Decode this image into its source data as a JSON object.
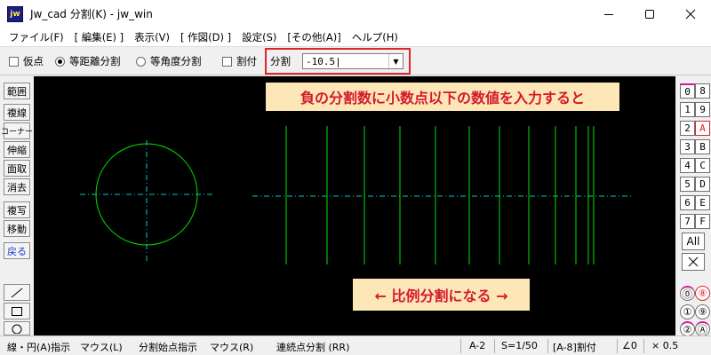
{
  "window": {
    "title": "Jw_cad 分割(K) - jw_win",
    "app_icon_text": "jw"
  },
  "menu": [
    "ファイル(F)",
    "[ 編集(E) ]",
    "表示(V)",
    "[ 作図(D) ]",
    "設定(S)",
    "[その他(A)]",
    "ヘルプ(H)"
  ],
  "toolbar": {
    "karite": "仮点",
    "equal_distance": "等距離分割",
    "equal_angle": "等角度分割",
    "waritsuke": "割付",
    "division_label": "分割",
    "division_value": "-10.5|"
  },
  "left_buttons": [
    "範囲",
    "複線",
    "コーナー",
    "伸縮",
    "面取",
    "消去",
    "複写",
    "移動",
    "戻る"
  ],
  "right_buttons": {
    "col1": [
      "0",
      "1",
      "2",
      "3",
      "4",
      "5",
      "6",
      "7"
    ],
    "col2": [
      "8",
      "9",
      "A",
      "B",
      "C",
      "D",
      "E",
      "F"
    ],
    "all": "All",
    "circ_col1": [
      "⓪",
      "①",
      "②"
    ],
    "circ_col2": [
      "⑧",
      "⑨",
      "Ⓐ"
    ]
  },
  "annotations": {
    "top": "負の分割数に小数点以下の数値を入力すると",
    "bottom": "← 比例分割になる →"
  },
  "drawing": {
    "circle_color": "#00e000",
    "center_line_color": "#00c8c8",
    "division_line_color": "#00e000",
    "division_x": [
      322,
      368,
      410,
      450,
      490,
      528,
      562,
      595,
      625,
      648,
      662,
      668
    ]
  },
  "status": {
    "hint1": "線・円(A)指示",
    "mouse1": "マウス(L)",
    "hint2": "分割始点指示",
    "mouse2": "マウス(R)",
    "hint3": "連続点分割 (RR)",
    "layer": "A-2",
    "scale": "S=1/50",
    "mode": "[A-8]割付",
    "angle": "∠0",
    "zoom": "× 0.5"
  },
  "colors": {
    "highlight": "#e0242c",
    "callout_bg": "#fde7b6",
    "callout_text": "#d4182f",
    "canvas_bg": "#000000"
  }
}
